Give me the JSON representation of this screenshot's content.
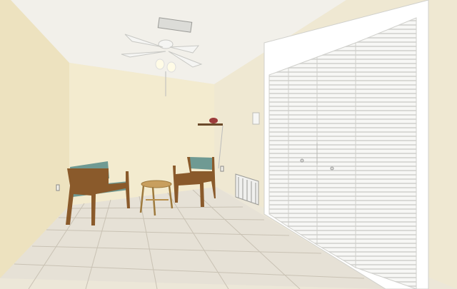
{
  "scene": {
    "kind": "interior-room-photo",
    "objects": [
      "ceiling-fan-with-light",
      "ceiling-air-vent",
      "armchair-left",
      "armchair-right",
      "round-rattan-side-table",
      "wall-shelf",
      "thermostat",
      "floor-air-vent",
      "louvered-bifold-closet-doors",
      "tile-floor"
    ]
  },
  "colors": {
    "ceiling": "#f2f0ea",
    "wall_left": "#ede2bf",
    "wall_back": "#f3ebcf",
    "wall_right": "#efe8d2",
    "floor": "#e6e1d6",
    "grout": "#c9c2b4",
    "door_white": "#f7f7f5",
    "door_shadow": "#d8d8d6",
    "chair_wood": "#8a5a2b",
    "chair_fabric": "#6f9a93",
    "rattan": "#c89f5e",
    "fan_white": "#f5f5f3"
  }
}
